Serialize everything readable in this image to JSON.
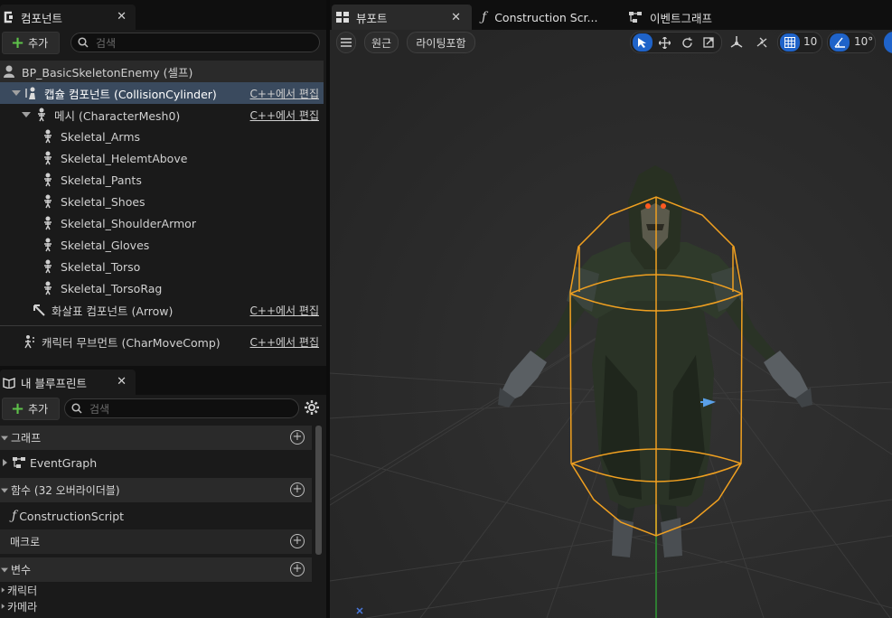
{
  "components_panel": {
    "tab_title": "컴포넌트",
    "add_label": "추가",
    "search_placeholder": "검색",
    "root": "BP_BasicSkeletonEnemy (셀프)",
    "edit_label": "C++에서 편집",
    "capsule": "캡슐 컴포넌트 (CollisionCylinder)",
    "mesh": "메시 (CharacterMesh0)",
    "children": [
      "Skeletal_Arms",
      "Skeletal_HelemtAbove",
      "Skeletal_Pants",
      "Skeletal_Shoes",
      "Skeletal_ShoulderArmor",
      "Skeletal_Gloves",
      "Skeletal_Torso",
      "Skeletal_TorsoRag"
    ],
    "arrow": "화살표 컴포넌트 (Arrow)",
    "movement": "캐릭터 무브먼트 (CharMoveComp)"
  },
  "blueprint_panel": {
    "tab_title": "내 블루프린트",
    "add_label": "추가",
    "search_placeholder": "검색",
    "graph_section": "그래프",
    "event_graph": "EventGraph",
    "functions_section": "함수 (32 오버라이더블)",
    "construction_script": "ConstructionScript",
    "macros_section": "매크로",
    "variables_section": "변수",
    "var_categories": [
      "캐릭터",
      "카메라"
    ]
  },
  "viewport": {
    "tabs": {
      "viewport": "뷰포트",
      "construction": "Construction Scr...",
      "event_graph": "이벤트그래프"
    },
    "perspective_label": "원근",
    "lighting_label": "라이팅포함",
    "grid_snap": "10",
    "rotation_snap": "10°",
    "accent_color": "#1f63c9",
    "capsule_color": "#f0a020"
  }
}
